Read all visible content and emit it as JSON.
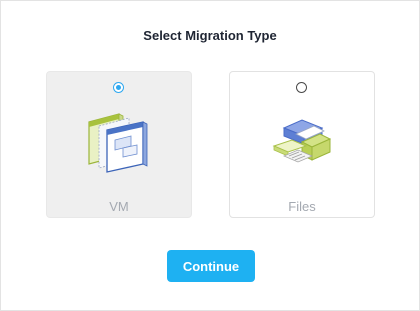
{
  "dialog": {
    "title": "Select Migration Type"
  },
  "options": [
    {
      "label": "VM",
      "selected": true,
      "icon": "vm-windows-icon"
    },
    {
      "label": "Files",
      "selected": false,
      "icon": "files-stack-icon"
    }
  ],
  "actions": {
    "continue_label": "Continue"
  },
  "colors": {
    "accent": "#1eb1f2",
    "radio_selected": "#2ea8f0",
    "selected_card_bg": "#efefef",
    "label_text": "#a4a9b1",
    "title_text": "#1f2533"
  }
}
